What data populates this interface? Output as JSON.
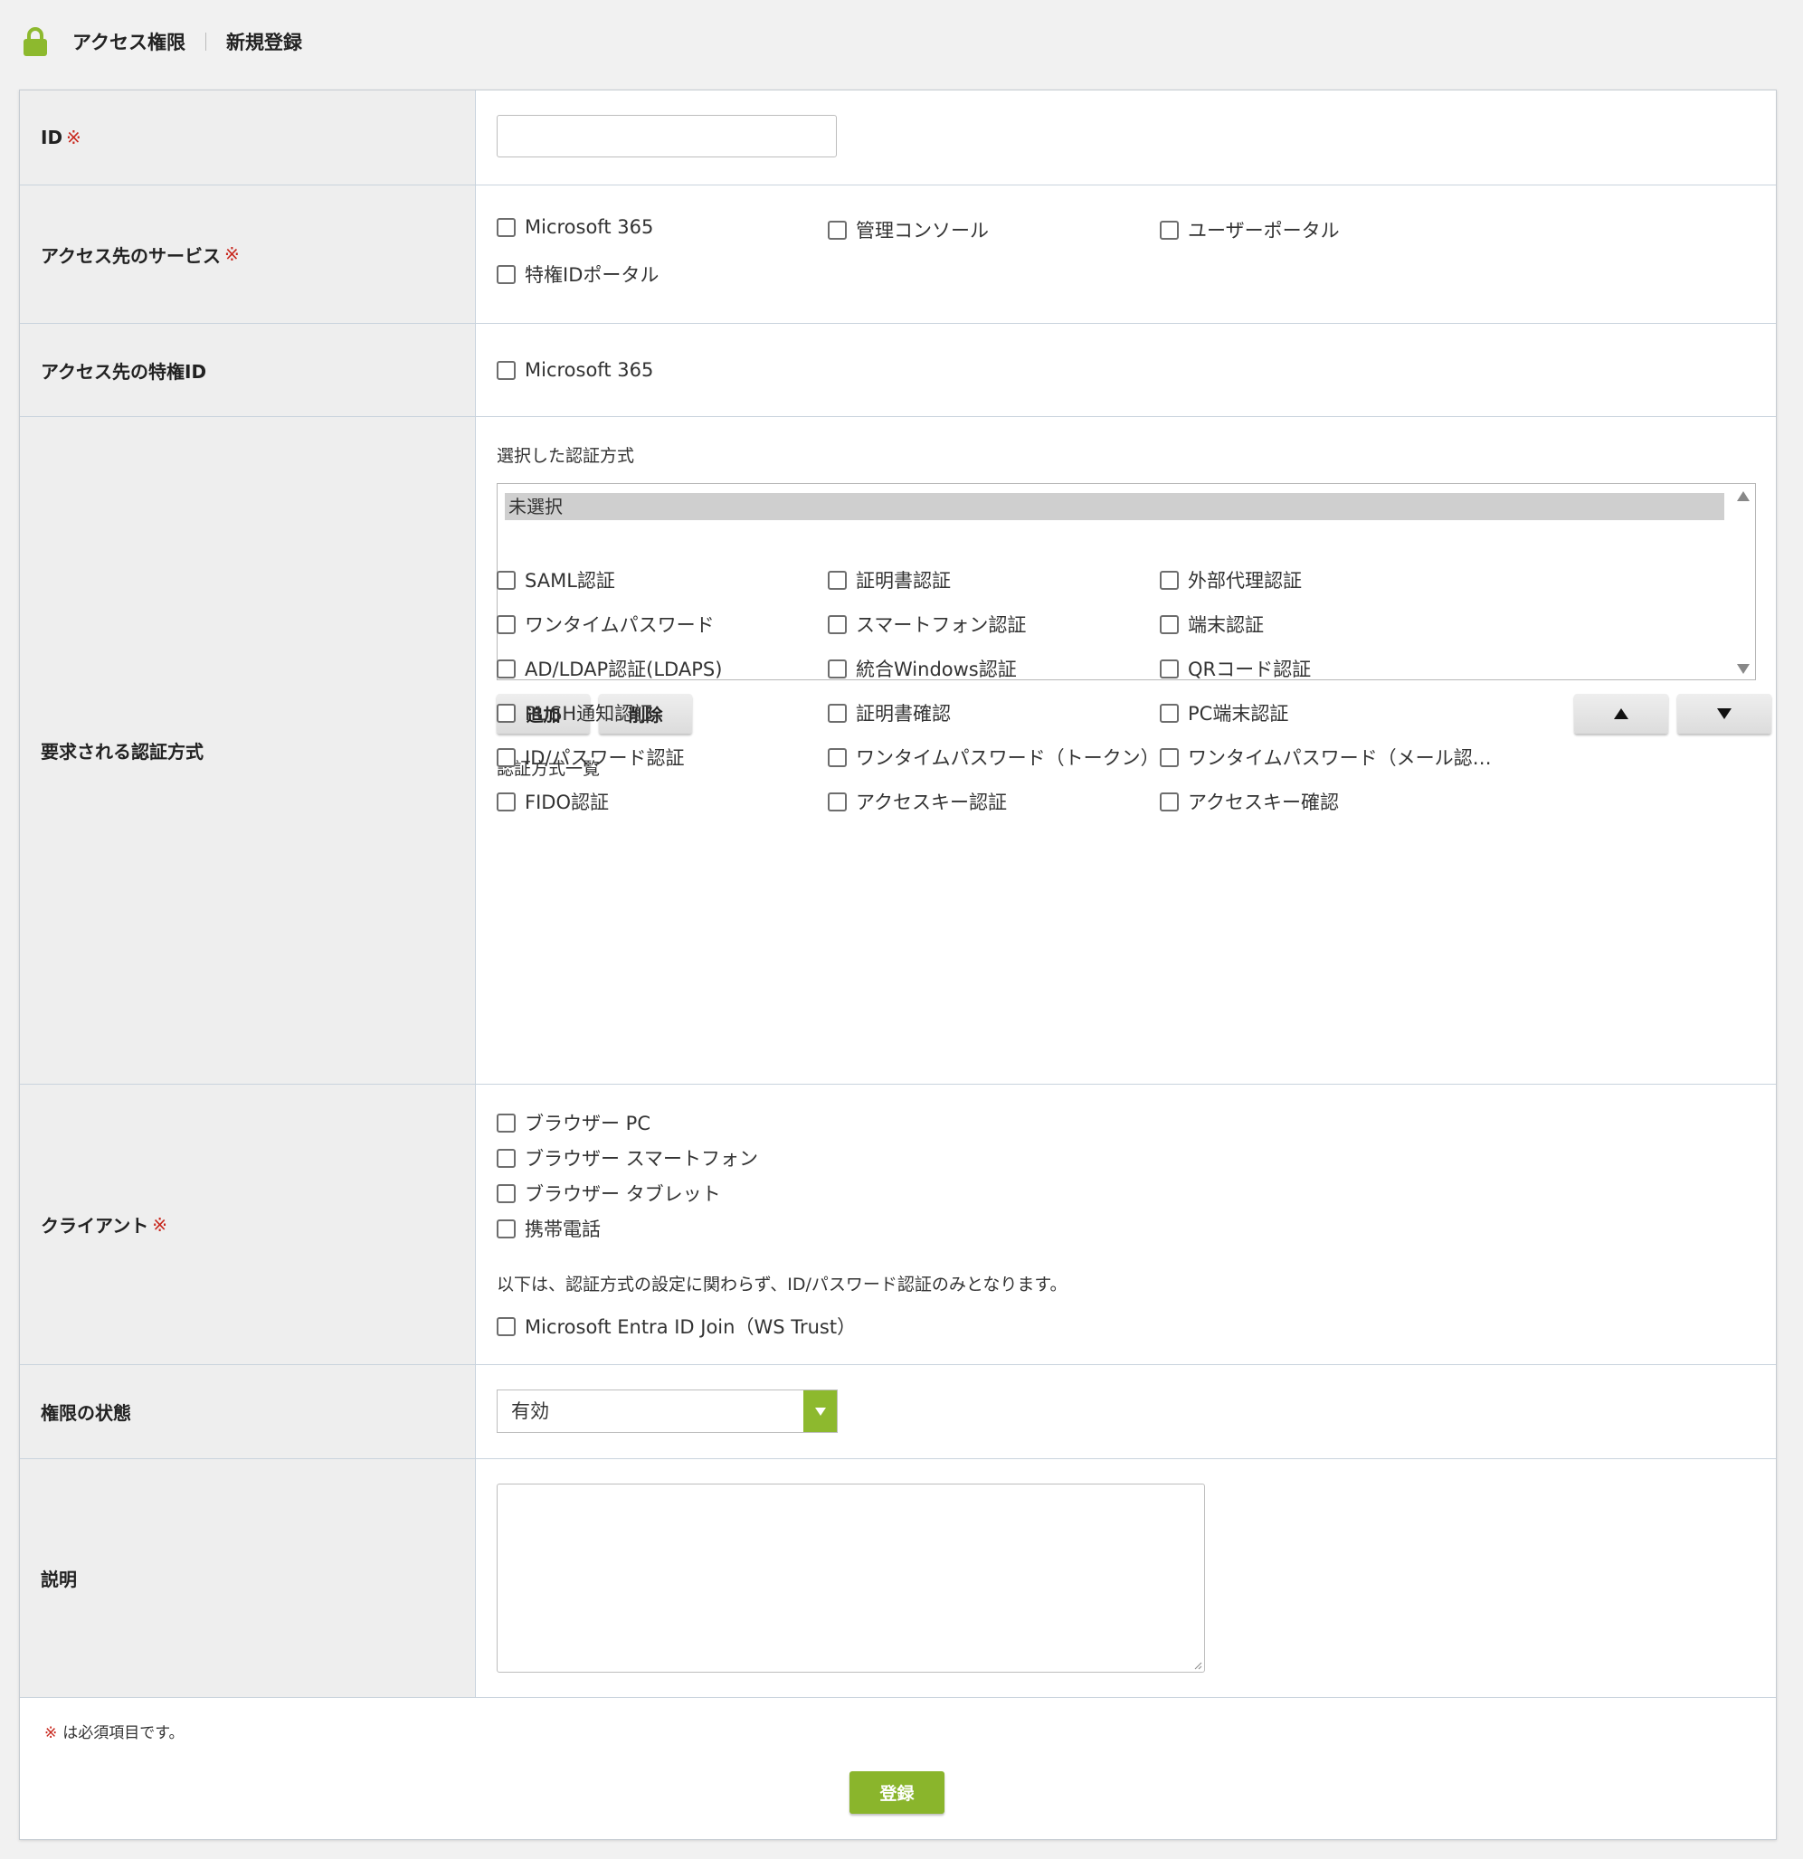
{
  "header": {
    "icon": "lock-icon",
    "accent_color": "#8db92e",
    "breadcrumb": [
      "アクセス権限",
      "新規登録"
    ]
  },
  "required_mark": "※",
  "form": {
    "id": {
      "label": "ID",
      "value": ""
    },
    "services": {
      "label": "アクセス先のサービス",
      "options": [
        "Microsoft 365",
        "管理コンソール",
        "ユーザーポータル",
        "特権IDポータル"
      ]
    },
    "privileged_ids": {
      "label": "アクセス先の特権ID",
      "options": [
        "Microsoft 365"
      ]
    },
    "auth": {
      "label": "要求される認証方式",
      "selected_caption": "選択した認証方式",
      "selected_items": [
        "未選択"
      ],
      "add_label": "追加",
      "delete_label": "削除",
      "list_caption": "認証方式一覧",
      "methods": [
        "SAML認証",
        "証明書認証",
        "外部代理認証",
        "ワンタイムパスワード",
        "スマートフォン認証",
        "端末認証",
        "AD/LDAP認証(LDAPS)",
        "統合Windows認証",
        "QRコード認証",
        "PUSH通知認証",
        "証明書確認",
        "PC端末認証",
        "ID/パスワード認証",
        "ワンタイムパスワード（トークン）",
        "ワンタイムパスワード（メール認…",
        "FIDO認証",
        "アクセスキー認証",
        "アクセスキー確認"
      ]
    },
    "client": {
      "label": "クライアント",
      "options": [
        "ブラウザー PC",
        "ブラウザー スマートフォン",
        "ブラウザー タブレット",
        "携帯電話"
      ],
      "note": "以下は、認証方式の設定に関わらず、ID/パスワード認証のみとなります。",
      "extra_option": "Microsoft Entra ID Join（WS Trust）"
    },
    "status": {
      "label": "権限の状態",
      "value": "有効"
    },
    "description": {
      "label": "説明",
      "value": ""
    }
  },
  "footer": {
    "required_note": "は必須項目です。",
    "submit_label": "登録"
  }
}
